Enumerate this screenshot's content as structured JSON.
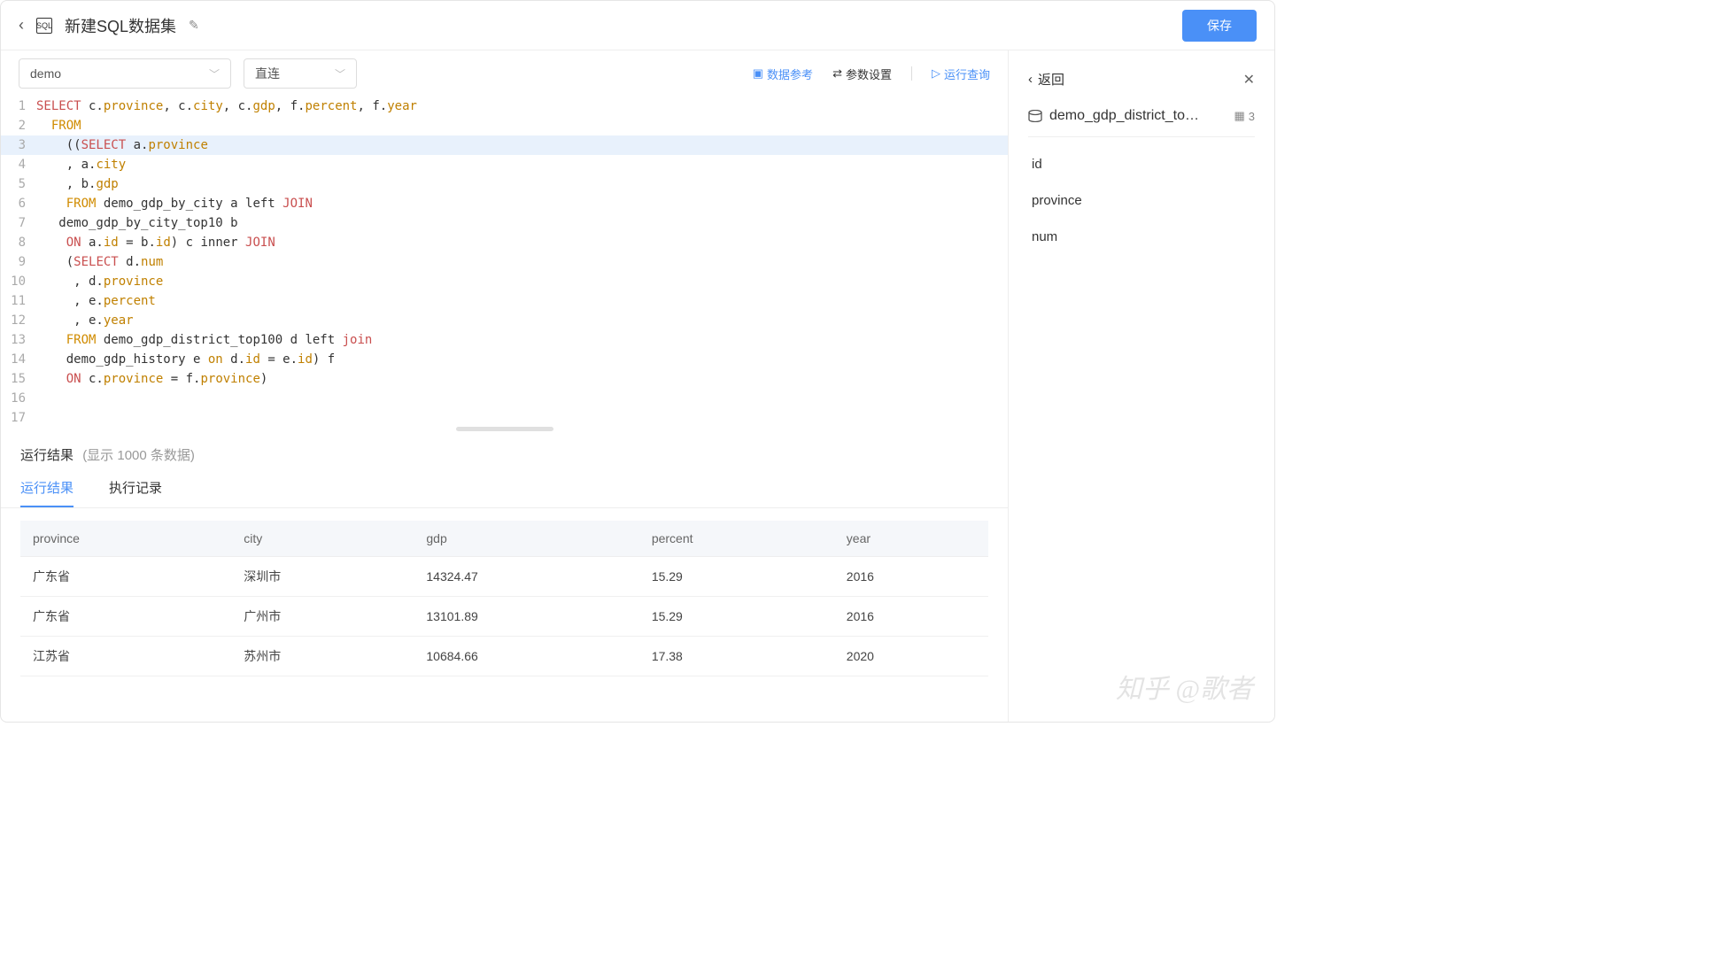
{
  "header": {
    "title": "新建SQL数据集",
    "save": "保存"
  },
  "toolbar": {
    "datasource": "demo",
    "mode": "直连",
    "dataRef": "数据参考",
    "paramSet": "参数设置",
    "runQuery": "运行查询"
  },
  "editor": {
    "highlighted_line": 3,
    "lines": [
      [
        [
          "k-sel",
          "SELECT"
        ],
        [
          "txt",
          " c."
        ],
        [
          "ident",
          "province"
        ],
        [
          "txt",
          ", c."
        ],
        [
          "ident",
          "city"
        ],
        [
          "txt",
          ", c."
        ],
        [
          "ident",
          "gdp"
        ],
        [
          "txt",
          ", f."
        ],
        [
          "ident",
          "percent"
        ],
        [
          "txt",
          ", f."
        ],
        [
          "ident",
          "year"
        ]
      ],
      [
        [
          "txt",
          "  "
        ],
        [
          "k-from",
          "FROM"
        ]
      ],
      [
        [
          "txt",
          "    (("
        ],
        [
          "k-sel",
          "SELECT"
        ],
        [
          "txt",
          " a."
        ],
        [
          "ident",
          "province"
        ]
      ],
      [
        [
          "txt",
          "    , a."
        ],
        [
          "ident",
          "city"
        ]
      ],
      [
        [
          "txt",
          "    , b."
        ],
        [
          "ident",
          "gdp"
        ]
      ],
      [
        [
          "txt",
          "    "
        ],
        [
          "k-from",
          "FROM"
        ],
        [
          "txt",
          " demo_gdp_by_city a left "
        ],
        [
          "k-join",
          "JOIN"
        ]
      ],
      [
        [
          "txt",
          "   demo_gdp_by_city_top10 b"
        ]
      ],
      [
        [
          "txt",
          "    "
        ],
        [
          "k-on",
          "ON"
        ],
        [
          "txt",
          " a."
        ],
        [
          "ident",
          "id"
        ],
        [
          "txt",
          " = b."
        ],
        [
          "ident",
          "id"
        ],
        [
          "txt",
          ") c inner "
        ],
        [
          "k-join",
          "JOIN"
        ]
      ],
      [
        [
          "txt",
          "    ("
        ],
        [
          "k-sel",
          "SELECT"
        ],
        [
          "txt",
          " d."
        ],
        [
          "ident",
          "num"
        ]
      ],
      [
        [
          "txt",
          "     , d."
        ],
        [
          "ident",
          "province"
        ]
      ],
      [
        [
          "txt",
          "     , e."
        ],
        [
          "ident",
          "percent"
        ]
      ],
      [
        [
          "txt",
          "     , e."
        ],
        [
          "ident",
          "year"
        ]
      ],
      [
        [
          "txt",
          "    "
        ],
        [
          "k-from",
          "FROM"
        ],
        [
          "txt",
          " demo_gdp_district_top100 d left "
        ],
        [
          "k-join",
          "join"
        ]
      ],
      [
        [
          "txt",
          "    demo_gdp_history e "
        ],
        [
          "ident",
          "on"
        ],
        [
          "txt",
          " d."
        ],
        [
          "ident",
          "id"
        ],
        [
          "txt",
          " = e."
        ],
        [
          "ident",
          "id"
        ],
        [
          "txt",
          ") f"
        ]
      ],
      [
        [
          "txt",
          "    "
        ],
        [
          "k-on",
          "ON"
        ],
        [
          "txt",
          " c."
        ],
        [
          "ident",
          "province"
        ],
        [
          "txt",
          " = f."
        ],
        [
          "ident",
          "province"
        ],
        [
          "txt",
          ")"
        ]
      ],
      [
        [
          "txt",
          ""
        ]
      ],
      [
        [
          "txt",
          ""
        ]
      ]
    ]
  },
  "results": {
    "title": "运行结果",
    "subtitle": "(显示 1000 条数据)",
    "tabs": [
      "运行结果",
      "执行记录"
    ],
    "active_tab": 0,
    "columns": [
      "province",
      "city",
      "gdp",
      "percent",
      "year"
    ],
    "rows": [
      [
        "广东省",
        "深圳市",
        "14324.47",
        "15.29",
        "2016"
      ],
      [
        "广东省",
        "广州市",
        "13101.89",
        "15.29",
        "2016"
      ],
      [
        "江苏省",
        "苏州市",
        "10684.66",
        "17.38",
        "2020"
      ]
    ]
  },
  "side": {
    "back": "返回",
    "table_name": "demo_gdp_district_to…",
    "count": "3",
    "fields": [
      "id",
      "province",
      "num"
    ]
  },
  "watermark": "知乎 @歌者"
}
